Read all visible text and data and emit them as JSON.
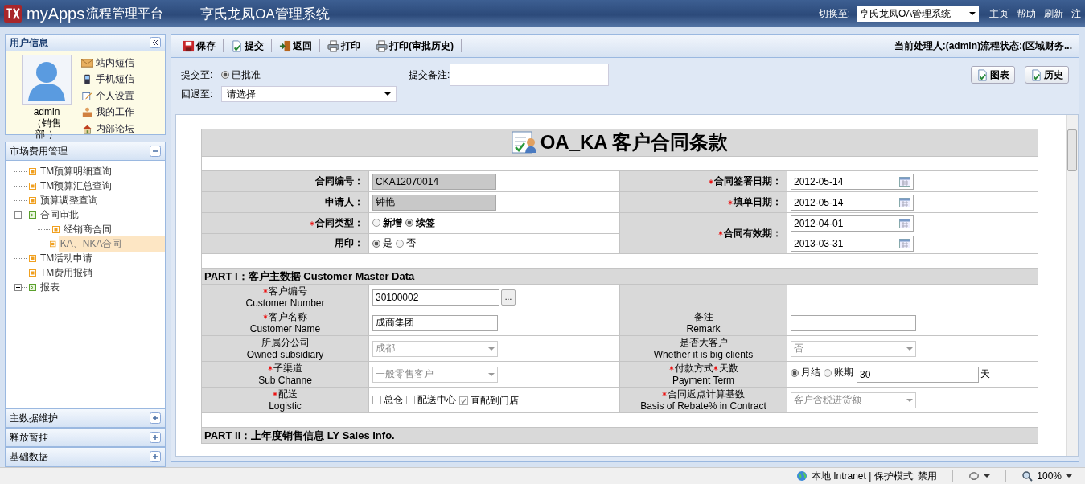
{
  "header": {
    "logo": "myApps",
    "platform": "流程管理平台",
    "system_title": "亨氏龙凤OA管理系统",
    "switch_label": "切换至:",
    "switch_value": "亨氏龙凤OA管理系统",
    "links": [
      "主页",
      "帮助",
      "刷新",
      "注"
    ]
  },
  "user_panel": {
    "title": "用户信息",
    "user": "admin",
    "dept": "（销售部 ）",
    "links": [
      {
        "label": "站内短信",
        "kind": "mail"
      },
      {
        "label": "手机短信",
        "kind": "phone"
      },
      {
        "label": "个人设置",
        "kind": "edit"
      },
      {
        "label": "我的工作",
        "kind": "work"
      },
      {
        "label": "内部论坛",
        "kind": "home"
      }
    ]
  },
  "nav": [
    {
      "title": "市场费用管理",
      "expanded": true,
      "tree": [
        {
          "label": "TM预算明细查询",
          "kind": "leaf",
          "selected": false
        },
        {
          "label": "TM预算汇总查询",
          "kind": "leaf",
          "selected": false
        },
        {
          "label": "预算调整查询",
          "kind": "leaf",
          "selected": false
        },
        {
          "label": "合同审批",
          "kind": "folder",
          "expanded": true,
          "selected": false,
          "children": [
            {
              "label": "经销商合同",
              "kind": "leaf",
              "selected": false
            },
            {
              "label": "KA、NKA合同",
              "kind": "leaf",
              "selected": true
            }
          ]
        },
        {
          "label": "TM活动申请",
          "kind": "leaf",
          "selected": false
        },
        {
          "label": "TM费用报销",
          "kind": "leaf",
          "selected": false
        },
        {
          "label": "报表",
          "kind": "folder",
          "expanded": false,
          "selected": false
        }
      ]
    },
    {
      "title": "主数据维护",
      "expanded": false
    },
    {
      "title": "释放暂挂",
      "expanded": false
    },
    {
      "title": "基础数据",
      "expanded": false
    }
  ],
  "toolbar": {
    "buttons": [
      {
        "label": "保存",
        "kind": "save"
      },
      {
        "label": "提交",
        "kind": "submit"
      },
      {
        "label": "返回",
        "kind": "back"
      },
      {
        "label": "打印",
        "kind": "print"
      },
      {
        "label": "打印(审批历史)",
        "kind": "print"
      }
    ],
    "status": "当前处理人:(admin)流程状态:(区域财务..."
  },
  "submit": {
    "to_label": "提交至:",
    "to_options": [
      {
        "label": "已批准",
        "selected": true
      }
    ],
    "note_label": "提交备注:",
    "back_label": "回退至:",
    "back_value": "请选择",
    "buttons": [
      "图表",
      "历史"
    ]
  },
  "form": {
    "title": "OA_KA 客户合同条款",
    "header": {
      "left": [
        {
          "label": "合同编号：",
          "required": false,
          "field": {
            "kind": "readonly",
            "value": "CKA12070014"
          }
        },
        {
          "label": "申请人：",
          "required": false,
          "field": {
            "kind": "readonly",
            "value": "钟艳"
          }
        },
        {
          "label": "合同类型：",
          "required": true,
          "field": {
            "kind": "radio",
            "bold": true,
            "options": [
              {
                "label": "新增",
                "selected": false
              },
              {
                "label": "续签",
                "selected": true
              }
            ]
          }
        },
        {
          "label": "用印：",
          "required": false,
          "field": {
            "kind": "radio",
            "bold": false,
            "options": [
              {
                "label": "是",
                "selected": true
              },
              {
                "label": "否",
                "selected": false
              }
            ]
          }
        }
      ],
      "right": [
        {
          "label": "合同签署日期：",
          "required": true,
          "fields": [
            {
              "kind": "date",
              "value": "2012-05-14"
            }
          ]
        },
        {
          "label": "填单日期：",
          "required": true,
          "fields": [
            {
              "kind": "date",
              "value": "2012-05-14"
            }
          ]
        },
        {
          "label": "合同有效期：",
          "required": true,
          "fields": [
            {
              "kind": "date",
              "value": "2012-04-01"
            },
            {
              "kind": "date",
              "value": "2013-03-31"
            }
          ]
        }
      ]
    },
    "sections": [
      {
        "title": "PART I：客户主数据  Customer Master Data",
        "rows": [
          {
            "cells": [
              {
                "kind": "field",
                "label": [
                  {
                    "text": "客户编号",
                    "required": true
                  }
                ],
                "en": "Customer Number",
                "field": {
                  "kind": "lookup",
                  "value": "30100002",
                  "button": "..."
                }
              },
              {
                "kind": "empty"
              }
            ]
          },
          {
            "cells": [
              {
                "kind": "field",
                "label": [
                  {
                    "text": "客户名称",
                    "required": true
                  }
                ],
                "en": "Customer Name",
                "field": {
                  "kind": "text",
                  "value": "成商集团"
                }
              },
              {
                "kind": "field",
                "label": [
                  {
                    "text": "备注",
                    "required": false
                  }
                ],
                "en": "Remark",
                "field": {
                  "kind": "text"
                }
              }
            ]
          },
          {
            "cells": [
              {
                "kind": "field",
                "label": [
                  {
                    "text": "所属分公司",
                    "required": false
                  }
                ],
                "en": "Owned subsidiary",
                "field": {
                  "kind": "select",
                  "value": "成都",
                  "disabled": true
                }
              },
              {
                "kind": "field",
                "label": [
                  {
                    "text": "是否大客户",
                    "required": false
                  }
                ],
                "en": "Whether it is big clients",
                "field": {
                  "kind": "select",
                  "value": "否",
                  "disabled": true
                }
              }
            ]
          },
          {
            "cells": [
              {
                "kind": "field",
                "label": [
                  {
                    "text": "子渠道",
                    "required": true
                  }
                ],
                "en": "Sub Channe",
                "field": {
                  "kind": "select",
                  "value": "一般零售客户",
                  "disabled": true
                }
              },
              {
                "kind": "field",
                "label": [
                  {
                    "text": "付款方式",
                    "required": true
                  },
                  {
                    "text": "天数",
                    "required": true
                  }
                ],
                "en": "Payment Term",
                "field": {
                  "kind": "radio_input",
                  "options": [
                    {
                      "label": "月结",
                      "selected": true
                    },
                    {
                      "label": "账期",
                      "selected": false
                    }
                  ],
                  "value": "30",
                  "suffix": "天"
                }
              }
            ]
          },
          {
            "cells": [
              {
                "kind": "field",
                "label": [
                  {
                    "text": "配送",
                    "required": true
                  }
                ],
                "en": "Logistic",
                "field": {
                  "kind": "checks",
                  "options": [
                    {
                      "label": "总仓",
                      "checked": false
                    },
                    {
                      "label": "配送中心",
                      "checked": false
                    },
                    {
                      "label": "直配到门店",
                      "checked": true
                    }
                  ]
                }
              },
              {
                "kind": "field",
                "label": [
                  {
                    "text": "合同返点计算基数",
                    "required": true
                  }
                ],
                "en": "Basis of Rebate% in Contract",
                "field": {
                  "kind": "select",
                  "value": "客户含税进货额",
                  "disabled": true
                }
              }
            ]
          }
        ]
      },
      {
        "title": "PART II：上年度销售信息  LY Sales Info."
      }
    ]
  },
  "status_bar": {
    "zone": "本地 Intranet | 保护模式: 禁用",
    "zoom": "100%"
  }
}
